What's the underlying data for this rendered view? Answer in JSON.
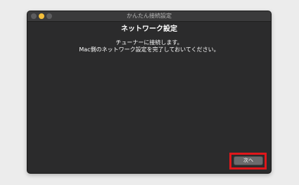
{
  "window": {
    "title": "かんたん接続設定"
  },
  "heading": "ネットワーク設定",
  "message": {
    "line1": "チューナーに接続します。",
    "line2": "Mac側のネットワーク設定を完了しておいてください。"
  },
  "buttons": {
    "next_label": "次へ"
  },
  "colors": {
    "window_bg": "#2b2b2c",
    "titlebar_bg": "#3a3a3b",
    "highlight": "#e0171b",
    "minimize_light": "#f5bf3b"
  }
}
